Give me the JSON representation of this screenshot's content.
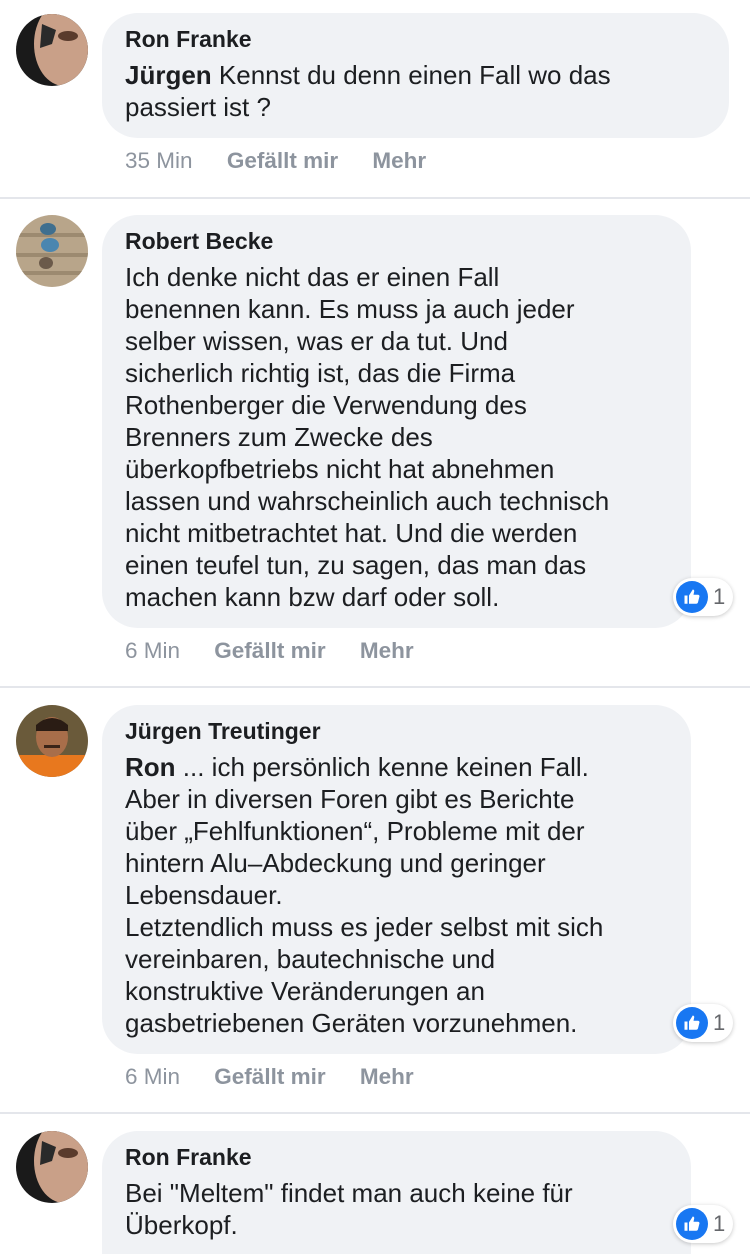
{
  "comments": [
    {
      "author": "Ron Franke",
      "mention": "Jürgen",
      "text": " Kennst du denn einen Fall wo das\npassiert ist ?",
      "time": "35 Min",
      "like_label": "Gefällt mir",
      "more_label": "Mehr",
      "reaction_count": ""
    },
    {
      "author": "Robert Becke",
      "mention": "",
      "text": "Ich denke nicht das er einen Fall\nbenennen kann. Es muss ja auch jeder\nselber wissen, was er da tut. Und\nsicherlich richtig ist, das die Firma\nRothenberger die Verwendung des\nBrenners zum Zwecke des\nüberkopfbetriebs nicht hat abnehmen\nlassen und wahrscheinlich auch technisch\nnicht mitbetrachtet hat. Und die werden\neinen teufel tun, zu sagen, das man das\nmachen kann bzw darf oder soll.",
      "time": "6 Min",
      "like_label": "Gefällt mir",
      "more_label": "Mehr",
      "reaction_count": "1"
    },
    {
      "author": "Jürgen Treutinger",
      "mention": "Ron",
      "text": " ... ich persönlich kenne keinen Fall.\nAber in diversen Foren gibt es Berichte\nüber „Fehlfunktionen“, Probleme mit der\nhintern Alu–Abdeckung und geringer\nLebensdauer.\nLetztendlich muss es jeder selbst mit sich\nvereinbaren, bautechnische und\nkonstruktive Veränderungen an\ngasbetriebenen Geräten vorzunehmen.",
      "time": "6 Min",
      "like_label": "Gefällt mir",
      "more_label": "Mehr",
      "reaction_count": "1"
    },
    {
      "author": "Ron Franke",
      "mention": "",
      "text": "Bei \"Meltem\" findet man auch keine für\nÜberkopf.",
      "time": "",
      "like_label": "",
      "more_label": "",
      "reaction_count": "1"
    }
  ],
  "colors": {
    "bubble": "#f0f2f5",
    "meta_text": "#8d949e",
    "like_blue": "#1877f2"
  },
  "icons": {
    "reaction": "thumbs-up-icon"
  }
}
